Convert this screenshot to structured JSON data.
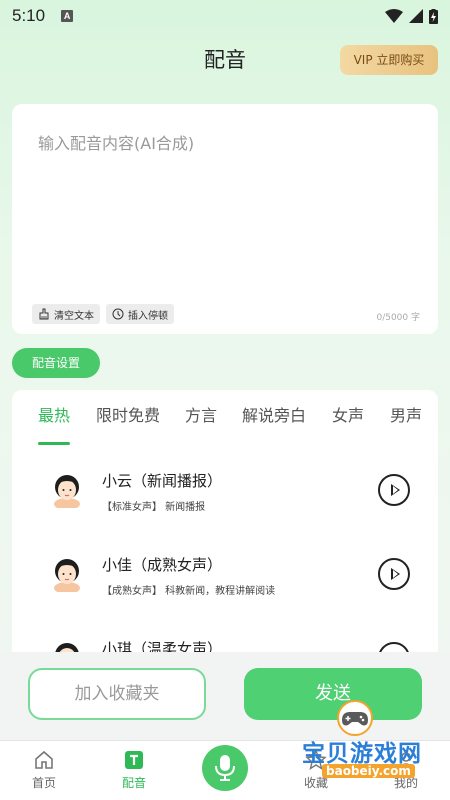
{
  "status": {
    "time": "5:10",
    "a_badge": "A"
  },
  "header": {
    "title": "配音",
    "vip_label": "VIP 立即购买"
  },
  "editor": {
    "placeholder": "输入配音内容(AI合成)",
    "clear_label": "清空文本",
    "pause_label": "插入停顿",
    "char_count": "0/5000 字"
  },
  "settings": {
    "label": "配音设置"
  },
  "tabs": [
    "最热",
    "限时免费",
    "方言",
    "解说旁白",
    "女声",
    "男声"
  ],
  "voices": [
    {
      "name": "小云（新闻播报）",
      "desc": "【标准女声】 新闻播报"
    },
    {
      "name": "小佳（成熟女声）",
      "desc": "【成熟女声】 科教新闻，教程讲解阅读"
    },
    {
      "name": "小琪（温柔女声）",
      "desc": ""
    }
  ],
  "actions": {
    "favorite_label": "加入收藏夹",
    "send_label": "发送"
  },
  "nav": {
    "home": "首页",
    "dubbing": "配音",
    "favorites": "收藏",
    "mine": "我的"
  },
  "watermark": {
    "text": "宝贝游戏网",
    "url": "baobeiy.com"
  },
  "colors": {
    "accent": "#49c96a",
    "vip": "#e8c27f"
  }
}
